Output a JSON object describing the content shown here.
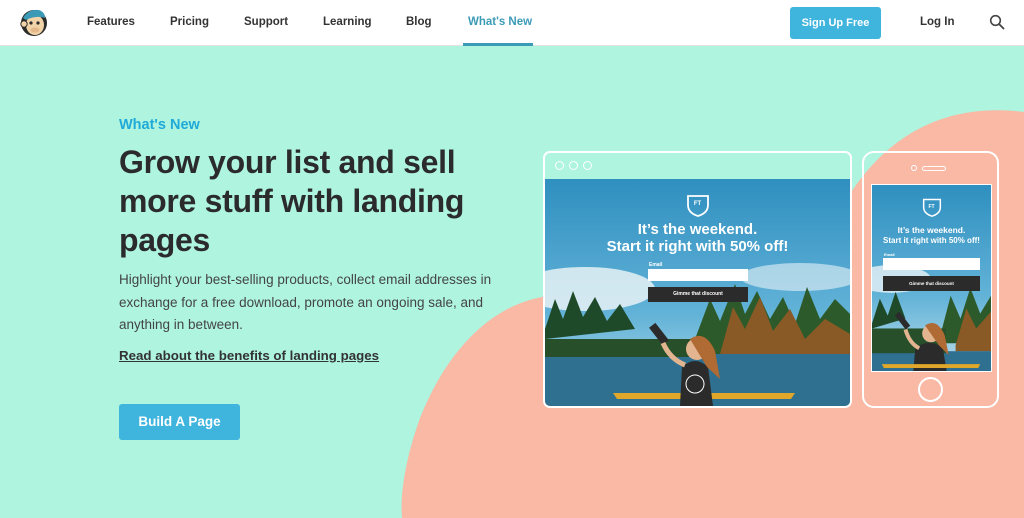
{
  "nav": {
    "links": [
      "Features",
      "Pricing",
      "Support",
      "Learning",
      "Blog",
      "What's New"
    ],
    "active_index": 5,
    "signup_label": "Sign Up Free",
    "login_label": "Log In",
    "logo_icon": "mailchimp-freddie-logo",
    "search_icon": "search-icon"
  },
  "hero": {
    "eyebrow": "What's New",
    "headline": "Grow your list and sell more stuff with landing pages",
    "body": "Highlight your best-selling products, collect email addresses in exchange for a free download, promote an ongoing sale, and anything in between.",
    "link_label": "Read about the benefits of landing pages",
    "cta_label": "Build A Page"
  },
  "mockup": {
    "brand_badge": "FT",
    "promo_line1": "It’s the weekend.",
    "promo_line2": "Start it right with 50% off!",
    "email_label": "Email",
    "button_label": "Gimme that discount"
  },
  "colors": {
    "background": "#aef4df",
    "accent_shape": "#f9b9a5",
    "brand_blue": "#3fb4dd",
    "active_link": "#3b9ab6",
    "headline": "#2b2b2b"
  }
}
